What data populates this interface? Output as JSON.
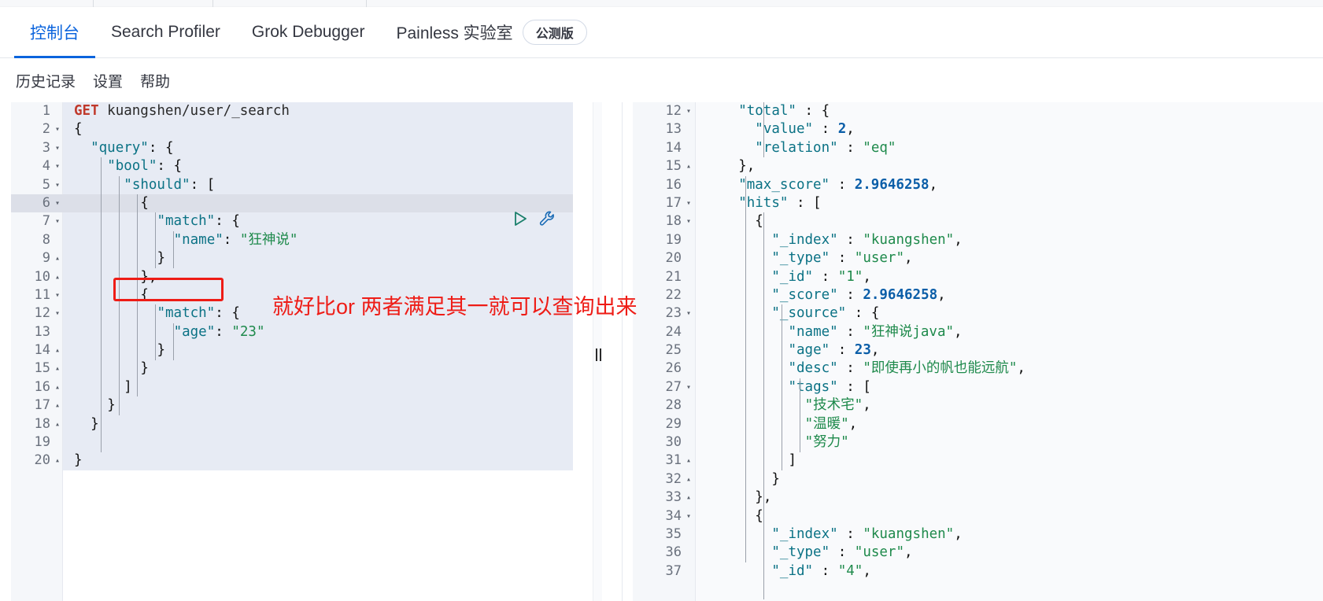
{
  "app": {
    "name": "Kibana Dev Tools Console",
    "accent_color": "#0b64dd",
    "annotation_color": "#ee1c16"
  },
  "tabs": [
    {
      "label": "控制台",
      "active": true
    },
    {
      "label": "Search Profiler",
      "active": false
    },
    {
      "label": "Grok Debugger",
      "active": false
    },
    {
      "label": "Painless 实验室",
      "active": false
    }
  ],
  "beta_badge": {
    "label": "公测版"
  },
  "submenu": {
    "items": [
      {
        "label": "历史记录"
      },
      {
        "label": "设置"
      },
      {
        "label": "帮助"
      }
    ]
  },
  "icons": {
    "play": "play-icon",
    "wrench": "wrench-icon",
    "splitter": "splitter-grip-icon"
  },
  "annotations": {
    "red_text": "就好比or 两者满足其一就可以查询出来",
    "red_box_target": "\"should\": ["
  },
  "request_editor": {
    "name": "console-request-editor",
    "current_line": 6,
    "lines": [
      {
        "n": 1,
        "fold": "",
        "text": "GET kuangshen/user/_search",
        "type": "request-line"
      },
      {
        "n": 2,
        "fold": "▾",
        "text": "{"
      },
      {
        "n": 3,
        "fold": "▾",
        "text": "  \"query\": {"
      },
      {
        "n": 4,
        "fold": "▾",
        "text": "    \"bool\": {"
      },
      {
        "n": 5,
        "fold": "▾",
        "text": "      \"should\": ["
      },
      {
        "n": 6,
        "fold": "▾",
        "text": "        {"
      },
      {
        "n": 7,
        "fold": "▾",
        "text": "          \"match\": {"
      },
      {
        "n": 8,
        "fold": "",
        "text": "            \"name\": \"狂神说\""
      },
      {
        "n": 9,
        "fold": "▴",
        "text": "          }"
      },
      {
        "n": 10,
        "fold": "▴",
        "text": "        },"
      },
      {
        "n": 11,
        "fold": "▾",
        "text": "        {"
      },
      {
        "n": 12,
        "fold": "▾",
        "text": "          \"match\": {"
      },
      {
        "n": 13,
        "fold": "",
        "text": "            \"age\": \"23\""
      },
      {
        "n": 14,
        "fold": "▴",
        "text": "          }"
      },
      {
        "n": 15,
        "fold": "▴",
        "text": "        }"
      },
      {
        "n": 16,
        "fold": "▴",
        "text": "      ]"
      },
      {
        "n": 17,
        "fold": "▴",
        "text": "    }"
      },
      {
        "n": 18,
        "fold": "▴",
        "text": "  }"
      },
      {
        "n": 19,
        "fold": "",
        "text": ""
      },
      {
        "n": 20,
        "fold": "▴",
        "text": "}"
      }
    ]
  },
  "response_editor": {
    "name": "console-response-viewer",
    "first_visible_line": 12,
    "lines": [
      {
        "n": 12,
        "fold": "▾",
        "text": "    \"total\" : {"
      },
      {
        "n": 13,
        "fold": "",
        "text": "      \"value\" : 2,"
      },
      {
        "n": 14,
        "fold": "",
        "text": "      \"relation\" : \"eq\""
      },
      {
        "n": 15,
        "fold": "▴",
        "text": "    },"
      },
      {
        "n": 16,
        "fold": "",
        "text": "    \"max_score\" : 2.9646258,"
      },
      {
        "n": 17,
        "fold": "▾",
        "text": "    \"hits\" : ["
      },
      {
        "n": 18,
        "fold": "▾",
        "text": "      {"
      },
      {
        "n": 19,
        "fold": "",
        "text": "        \"_index\" : \"kuangshen\","
      },
      {
        "n": 20,
        "fold": "",
        "text": "        \"_type\" : \"user\","
      },
      {
        "n": 21,
        "fold": "",
        "text": "        \"_id\" : \"1\","
      },
      {
        "n": 22,
        "fold": "",
        "text": "        \"_score\" : 2.9646258,"
      },
      {
        "n": 23,
        "fold": "▾",
        "text": "        \"_source\" : {"
      },
      {
        "n": 24,
        "fold": "",
        "text": "          \"name\" : \"狂神说java\","
      },
      {
        "n": 25,
        "fold": "",
        "text": "          \"age\" : 23,"
      },
      {
        "n": 26,
        "fold": "",
        "text": "          \"desc\" : \"即使再小的帆也能远航\","
      },
      {
        "n": 27,
        "fold": "▾",
        "text": "          \"tags\" : ["
      },
      {
        "n": 28,
        "fold": "",
        "text": "            \"技术宅\","
      },
      {
        "n": 29,
        "fold": "",
        "text": "            \"温暖\","
      },
      {
        "n": 30,
        "fold": "",
        "text": "            \"努力\""
      },
      {
        "n": 31,
        "fold": "▴",
        "text": "          ]"
      },
      {
        "n": 32,
        "fold": "▴",
        "text": "        }"
      },
      {
        "n": 33,
        "fold": "▴",
        "text": "      },"
      },
      {
        "n": 34,
        "fold": "▾",
        "text": "      {"
      },
      {
        "n": 35,
        "fold": "",
        "text": "        \"_index\" : \"kuangshen\","
      },
      {
        "n": 36,
        "fold": "",
        "text": "        \"_type\" : \"user\","
      },
      {
        "n": 37,
        "fold": "",
        "text": "        \"_id\" : \"4\","
      }
    ]
  },
  "response_values": {
    "total_value": 2,
    "total_relation": "eq",
    "max_score": 2.9646258,
    "hits": [
      {
        "_index": "kuangshen",
        "_type": "user",
        "_id": "1",
        "_score": 2.9646258,
        "_source": {
          "name": "狂神说java",
          "age": 23,
          "desc": "即使再小的帆也能远航",
          "tags": [
            "技术宅",
            "温暖",
            "努力"
          ]
        }
      },
      {
        "_index": "kuangshen",
        "_type": "user",
        "_id": "4"
      }
    ]
  }
}
